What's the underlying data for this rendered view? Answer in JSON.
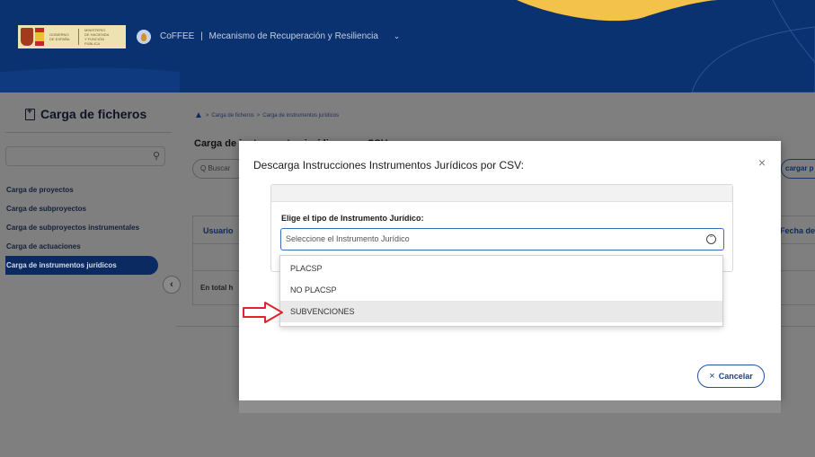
{
  "header": {
    "gov_logo_text": [
      "GOBIERNO DE ESPAÑA",
      "MINISTERIO DE HACIENDA Y FUNCIÓN PÚBLICA"
    ],
    "app_name": "CoFFEE",
    "separator": "|",
    "app_subtitle": "Mecanismo de Recuperación y Resiliencia",
    "colors": {
      "header_bg": "#0a3170",
      "accent_yellow": "#f2c24a"
    }
  },
  "sidebar": {
    "title": "Carga de ficheros",
    "items": [
      {
        "label": "Carga de proyectos",
        "active": false
      },
      {
        "label": "Carga de subproyectos",
        "active": false
      },
      {
        "label": "Carga de subproyectos instrumentales",
        "active": false
      },
      {
        "label": "Carga de actuaciones",
        "active": false
      },
      {
        "label": "Carga de instrumentos jurídicos",
        "active": true
      }
    ],
    "collapse_glyph": "‹"
  },
  "main": {
    "breadcrumb": [
      "Carga de ficheros",
      "Carga de instrumentos jurídicos"
    ],
    "breadcrumb_sep": ">",
    "page_title": "Carga de instrumentos jurídicos por CSV",
    "search_placeholder": "Q  Buscar",
    "upload_label": "cargar p",
    "table": {
      "col_user": "Usuario",
      "col_date": "Fecha de",
      "footer": "En total h"
    }
  },
  "modal": {
    "title": "Descarga Instrucciones Instrumentos Jurídicos por CSV:",
    "close_glyph": "×",
    "field_label": "Elige el tipo de Instrumento Jurídico:",
    "select_placeholder": "Seleccione el Instrumento Jurídico",
    "options": [
      "PLACSP",
      "NO PLACSP",
      "SUBVENCIONES"
    ],
    "highlighted_option": "SUBVENCIONES",
    "cancel_label": "Cancelar",
    "cancel_glyph": "×"
  }
}
